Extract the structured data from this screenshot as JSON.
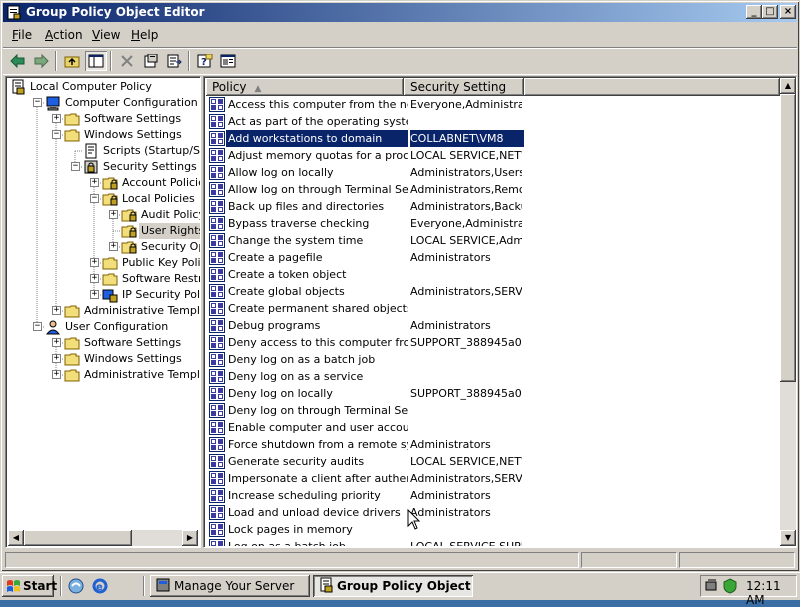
{
  "window": {
    "title": "Group Policy Object Editor"
  },
  "title_buttons": {
    "minimize": "_",
    "maximize": "□",
    "close": "×"
  },
  "menu": [
    {
      "id": "file",
      "label": "File",
      "accel": "F",
      "rest": "ile"
    },
    {
      "id": "action",
      "label": "Action",
      "accel": "A",
      "rest": "ction"
    },
    {
      "id": "view",
      "label": "View",
      "accel": "V",
      "rest": "iew"
    },
    {
      "id": "help",
      "label": "Help",
      "accel": "H",
      "rest": "elp"
    }
  ],
  "toolbar": [
    {
      "id": "back",
      "icon": "back-arrow-icon"
    },
    {
      "id": "forward",
      "icon": "forward-arrow-icon"
    },
    {
      "id": "up",
      "icon": "up-folder-icon"
    },
    {
      "id": "show-tree",
      "icon": "show-hide-tree-icon",
      "pressed": true
    },
    {
      "id": "delete",
      "icon": "delete-x-icon"
    },
    {
      "id": "properties",
      "icon": "properties-icon"
    },
    {
      "id": "export",
      "icon": "export-list-icon"
    },
    {
      "id": "help",
      "icon": "help-icon"
    },
    {
      "id": "console",
      "icon": "console-window-icon"
    }
  ],
  "tree": [
    {
      "label": "Local Computer Policy",
      "level": 0,
      "icon": "policy-icon",
      "expander": ""
    },
    {
      "label": "Computer Configuration",
      "level": 1,
      "icon": "computer-icon",
      "expander": "-"
    },
    {
      "label": "Software Settings",
      "level": 2,
      "icon": "folder-icon",
      "expander": "+"
    },
    {
      "label": "Windows Settings",
      "level": 2,
      "icon": "folder-icon",
      "expander": "-"
    },
    {
      "label": "Scripts (Startup/Shutdown)",
      "level": 3,
      "icon": "script-icon",
      "expander": ""
    },
    {
      "label": "Security Settings",
      "level": 3,
      "icon": "security-icon",
      "expander": "-"
    },
    {
      "label": "Account Policies",
      "level": 4,
      "icon": "locked-folder-icon",
      "expander": "+"
    },
    {
      "label": "Local Policies",
      "level": 4,
      "icon": "locked-folder-icon",
      "expander": "-"
    },
    {
      "label": "Audit Policy",
      "level": 5,
      "icon": "locked-folder-icon",
      "expander": "+"
    },
    {
      "label": "User Rights Assignment",
      "level": 5,
      "icon": "locked-folder-icon",
      "expander": "",
      "selected": true
    },
    {
      "label": "Security Options",
      "level": 5,
      "icon": "locked-folder-icon",
      "expander": "+"
    },
    {
      "label": "Public Key Policies",
      "level": 4,
      "icon": "folder-icon",
      "expander": "+"
    },
    {
      "label": "Software Restriction Policies",
      "level": 4,
      "icon": "folder-icon",
      "expander": "+"
    },
    {
      "label": "IP Security Policies",
      "level": 4,
      "icon": "ip-security-icon",
      "expander": "+"
    },
    {
      "label": "Administrative Templates",
      "level": 2,
      "icon": "folder-icon",
      "expander": "+"
    },
    {
      "label": "User Configuration",
      "level": 1,
      "icon": "user-icon",
      "expander": "-"
    },
    {
      "label": "Software Settings",
      "level": 2,
      "icon": "folder-icon",
      "expander": "+"
    },
    {
      "label": "Windows Settings",
      "level": 2,
      "icon": "folder-icon",
      "expander": "+"
    },
    {
      "label": "Administrative Templates",
      "level": 2,
      "icon": "folder-icon",
      "expander": "+"
    }
  ],
  "list": {
    "columns": {
      "policy": "Policy",
      "setting": "Security Setting"
    },
    "rows": [
      {
        "policy": "Access this computer from the network",
        "setting": "Everyone,Administrators,..."
      },
      {
        "policy": "Act as part of the operating system",
        "setting": ""
      },
      {
        "policy": "Add workstations to domain",
        "setting": "COLLABNET\\VM8",
        "selected": true
      },
      {
        "policy": "Adjust memory quotas for a process",
        "setting": "LOCAL SERVICE,NETWORK..."
      },
      {
        "policy": "Allow log on locally",
        "setting": "Administrators,Users..."
      },
      {
        "policy": "Allow log on through Terminal Services",
        "setting": "Administrators,Remote..."
      },
      {
        "policy": "Back up files and directories",
        "setting": "Administrators,Backup..."
      },
      {
        "policy": "Bypass traverse checking",
        "setting": "Everyone,Administrators..."
      },
      {
        "policy": "Change the system time",
        "setting": "LOCAL SERVICE,Admin..."
      },
      {
        "policy": "Create a pagefile",
        "setting": "Administrators"
      },
      {
        "policy": "Create a token object",
        "setting": ""
      },
      {
        "policy": "Create global objects",
        "setting": "Administrators,SERVICE"
      },
      {
        "policy": "Create permanent shared objects",
        "setting": ""
      },
      {
        "policy": "Debug programs",
        "setting": "Administrators"
      },
      {
        "policy": "Deny access to this computer from the network",
        "setting": "SUPPORT_388945a0"
      },
      {
        "policy": "Deny log on as a batch job",
        "setting": ""
      },
      {
        "policy": "Deny log on as a service",
        "setting": ""
      },
      {
        "policy": "Deny log on locally",
        "setting": "SUPPORT_388945a0"
      },
      {
        "policy": "Deny log on through Terminal Services",
        "setting": ""
      },
      {
        "policy": "Enable computer and user accounts to be trusted",
        "setting": ""
      },
      {
        "policy": "Force shutdown from a remote system",
        "setting": "Administrators"
      },
      {
        "policy": "Generate security audits",
        "setting": "LOCAL SERVICE,NETWORK..."
      },
      {
        "policy": "Impersonate a client after authentication",
        "setting": "Administrators,SERVICE"
      },
      {
        "policy": "Increase scheduling priority",
        "setting": "Administrators"
      },
      {
        "policy": "Load and unload device drivers",
        "setting": "Administrators"
      },
      {
        "policy": "Lock pages in memory",
        "setting": ""
      },
      {
        "policy": "Log on as a batch job",
        "setting": "LOCAL SERVICE,SUPPORT..."
      }
    ]
  },
  "taskbar": {
    "start_label": "Start",
    "tasks": [
      {
        "label": "Manage Your Server",
        "active": false
      },
      {
        "label": "Group Policy Object E...",
        "active": true
      }
    ],
    "clock": "12:11 AM"
  }
}
